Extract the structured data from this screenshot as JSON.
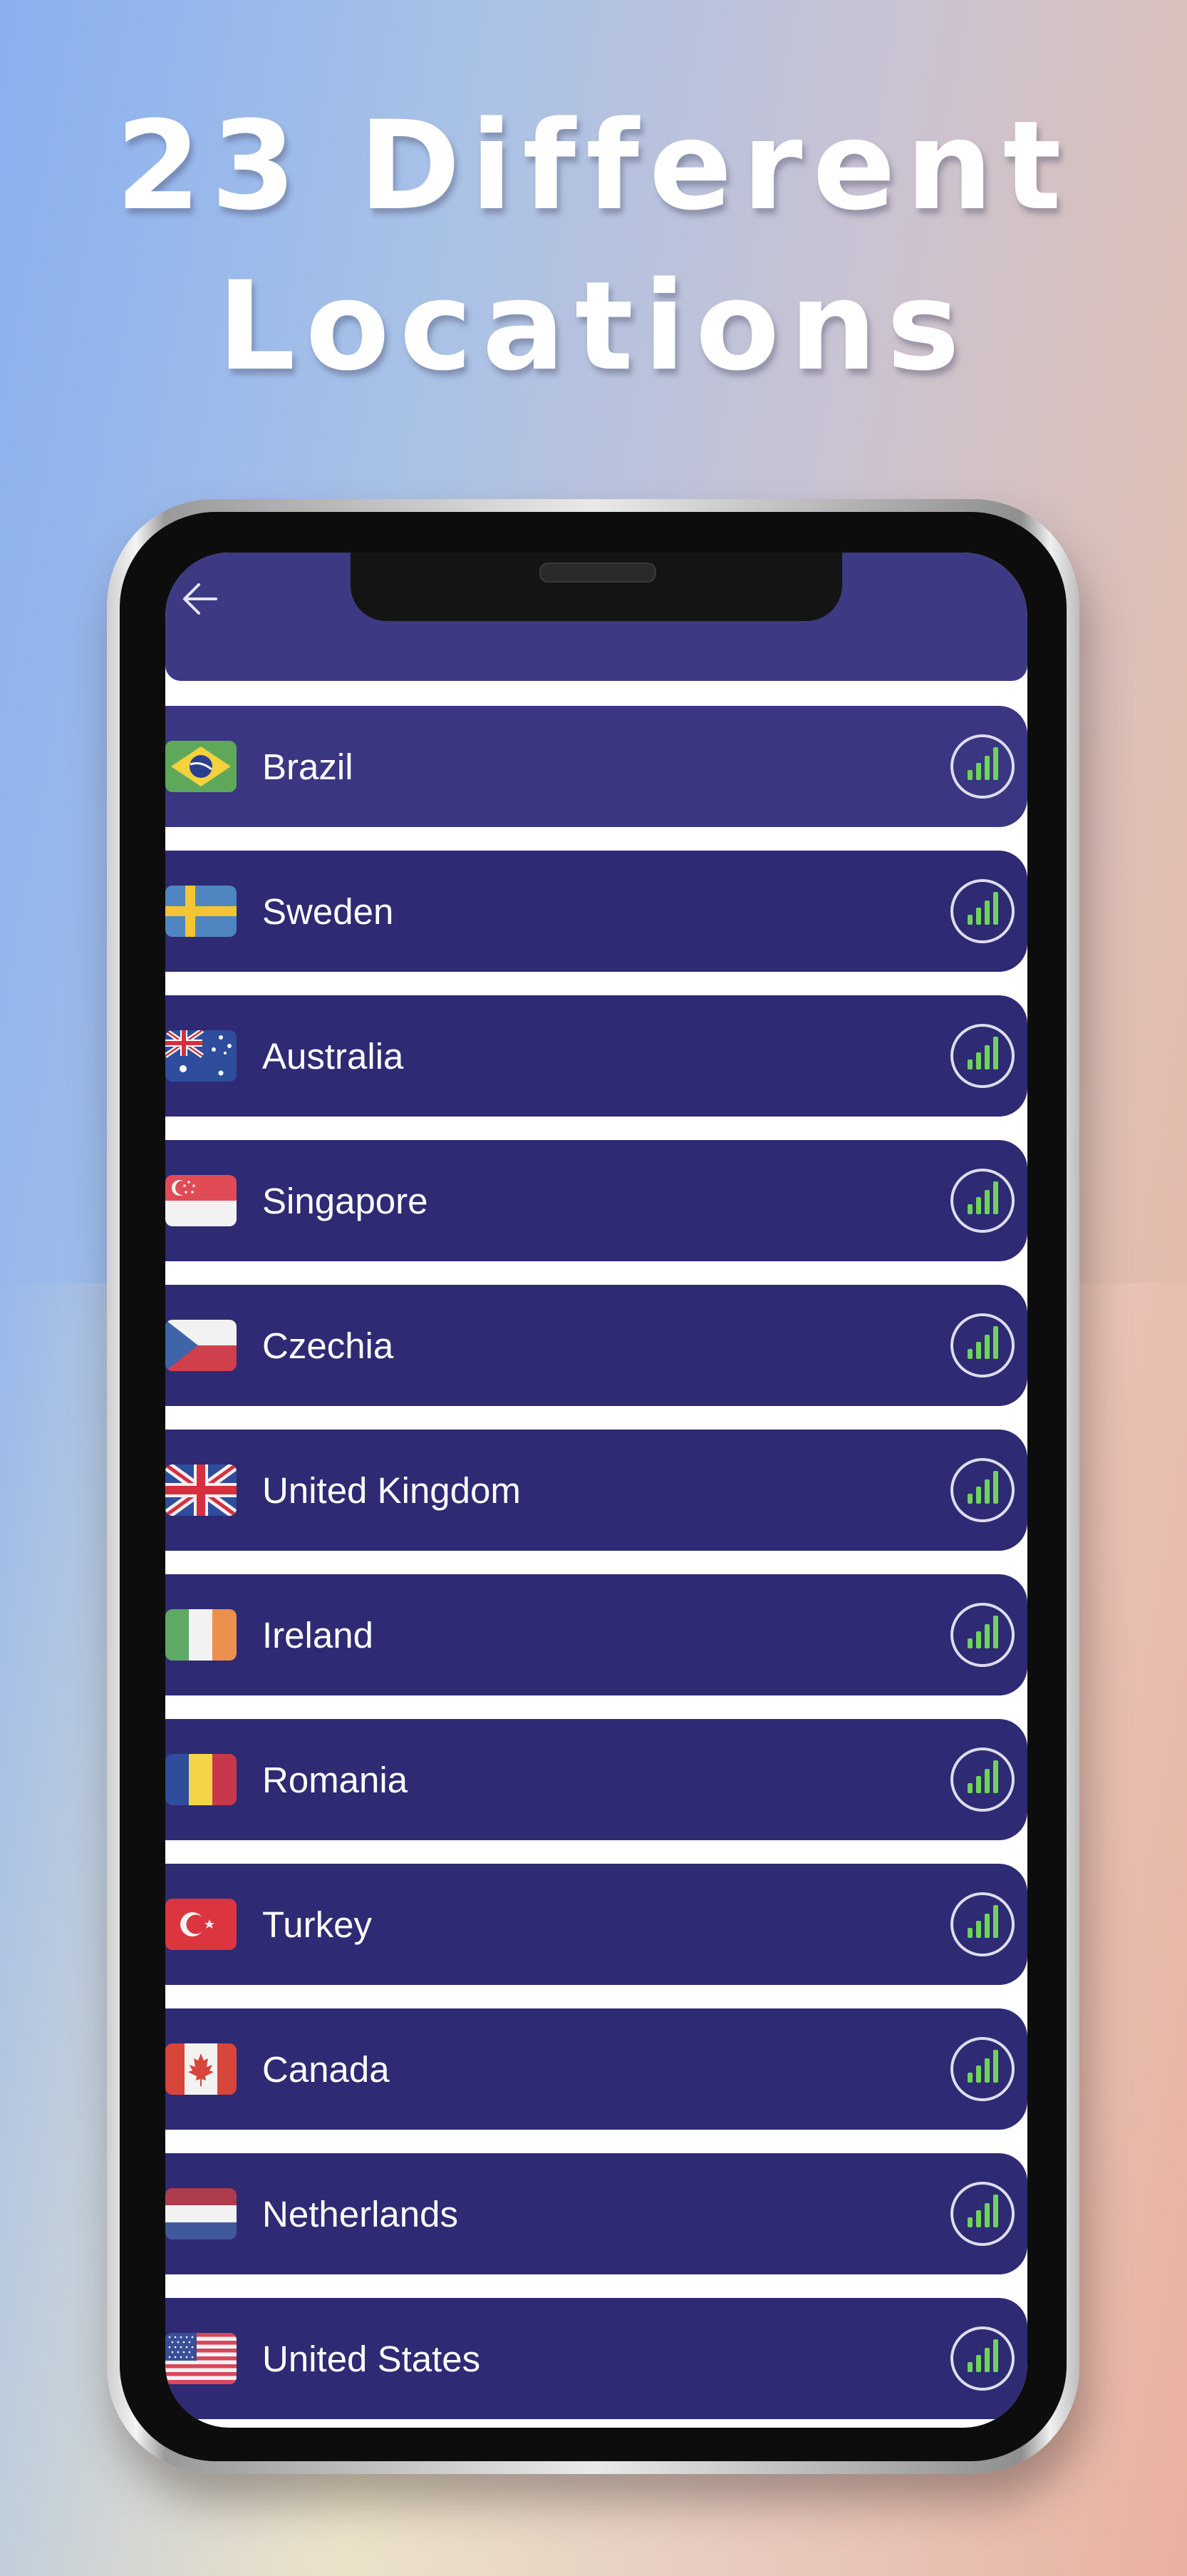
{
  "headline": {
    "line1": "23 Different",
    "line2": "Locations"
  },
  "header": {
    "back_icon": "arrow-left-icon"
  },
  "signal_icon": "signal-strength-icon",
  "colors": {
    "row_bg": "#2e2a73",
    "header_bg": "#3d3983",
    "signal_green": "#6fd35a",
    "divider": "#ffffff"
  },
  "countries": [
    {
      "name": "Brazil",
      "flag": "flag-brazil-icon",
      "signal_bars": 4
    },
    {
      "name": "Sweden",
      "flag": "flag-sweden-icon",
      "signal_bars": 4
    },
    {
      "name": "Australia",
      "flag": "flag-australia-icon",
      "signal_bars": 4
    },
    {
      "name": "Singapore",
      "flag": "flag-singapore-icon",
      "signal_bars": 4
    },
    {
      "name": "Czechia",
      "flag": "flag-czechia-icon",
      "signal_bars": 4
    },
    {
      "name": "United Kingdom",
      "flag": "flag-uk-icon",
      "signal_bars": 4
    },
    {
      "name": "Ireland",
      "flag": "flag-ireland-icon",
      "signal_bars": 4
    },
    {
      "name": "Romania",
      "flag": "flag-romania-icon",
      "signal_bars": 4
    },
    {
      "name": "Turkey",
      "flag": "flag-turkey-icon",
      "signal_bars": 4
    },
    {
      "name": "Canada",
      "flag": "flag-canada-icon",
      "signal_bars": 4
    },
    {
      "name": "Netherlands",
      "flag": "flag-netherlands-icon",
      "signal_bars": 4
    },
    {
      "name": "United States",
      "flag": "flag-usa-icon",
      "signal_bars": 4
    }
  ]
}
